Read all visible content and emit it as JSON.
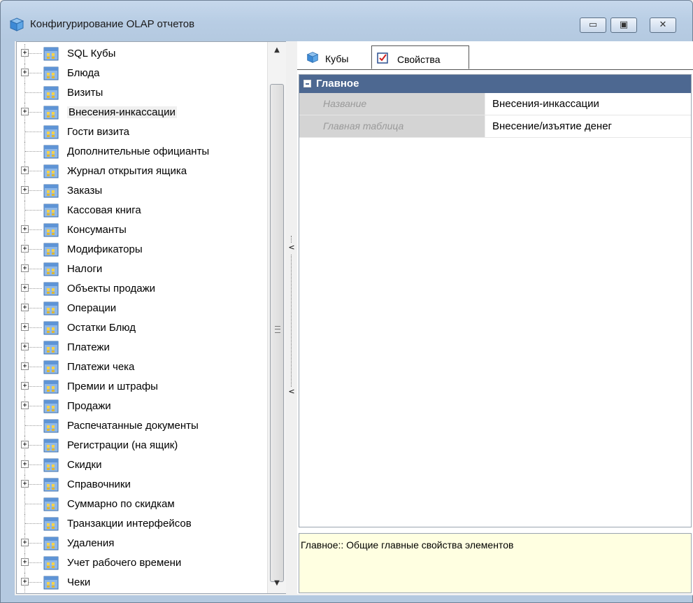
{
  "window": {
    "title": "Конфигурирование OLAP отчетов",
    "controls": {
      "minimize": "▭",
      "maximize": "▣",
      "close": "✕"
    }
  },
  "tree": {
    "selected_index": 3,
    "items": [
      {
        "label": "SQL Кубы",
        "expandable": true
      },
      {
        "label": "Блюда",
        "expandable": true
      },
      {
        "label": "Визиты",
        "expandable": false
      },
      {
        "label": "Внесения-инкассации",
        "expandable": true
      },
      {
        "label": "Гости визита",
        "expandable": false
      },
      {
        "label": "Дополнительные официанты",
        "expandable": false
      },
      {
        "label": "Журнал открытия ящика",
        "expandable": true
      },
      {
        "label": "Заказы",
        "expandable": true
      },
      {
        "label": "Кассовая книга",
        "expandable": false
      },
      {
        "label": "Консуманты",
        "expandable": true
      },
      {
        "label": "Модификаторы",
        "expandable": true
      },
      {
        "label": "Налоги",
        "expandable": true
      },
      {
        "label": "Объекты продажи",
        "expandable": true
      },
      {
        "label": "Операции",
        "expandable": true
      },
      {
        "label": "Остатки Блюд",
        "expandable": true
      },
      {
        "label": "Платежи",
        "expandable": true
      },
      {
        "label": "Платежи чека",
        "expandable": true
      },
      {
        "label": "Премии и штрафы",
        "expandable": true
      },
      {
        "label": "Продажи",
        "expandable": true
      },
      {
        "label": "Распечатанные документы",
        "expandable": false
      },
      {
        "label": "Регистрации (на ящик)",
        "expandable": true
      },
      {
        "label": "Скидки",
        "expandable": true
      },
      {
        "label": "Справочники",
        "expandable": true
      },
      {
        "label": "Суммарно по скидкам",
        "expandable": false
      },
      {
        "label": "Транзакции интерфейсов",
        "expandable": false
      },
      {
        "label": "Удаления",
        "expandable": true
      },
      {
        "label": "Учет рабочего времени",
        "expandable": true
      },
      {
        "label": "Чеки",
        "expandable": true
      }
    ],
    "expand_glyph": "+",
    "scroll_up": "▲",
    "scroll_down": "▼"
  },
  "splitter": {
    "collapse_glyph": "<"
  },
  "tabs": [
    {
      "label": "Кубы",
      "icon": "cube-icon",
      "active": false
    },
    {
      "label": "Свойства",
      "icon": "properties-check-icon",
      "active": true
    }
  ],
  "property_grid": {
    "category": "Главное",
    "rows": [
      {
        "name": "Название",
        "value": "Внесения-инкассации"
      },
      {
        "name": "Главная таблица",
        "value": "Внесение/изъятие денег"
      }
    ]
  },
  "description": "Главное:: Общие главные свойства элементов",
  "colors": {
    "category_bg": "#4d6891",
    "description_bg": "#ffffe1",
    "titlebar": "#b8cde4"
  }
}
